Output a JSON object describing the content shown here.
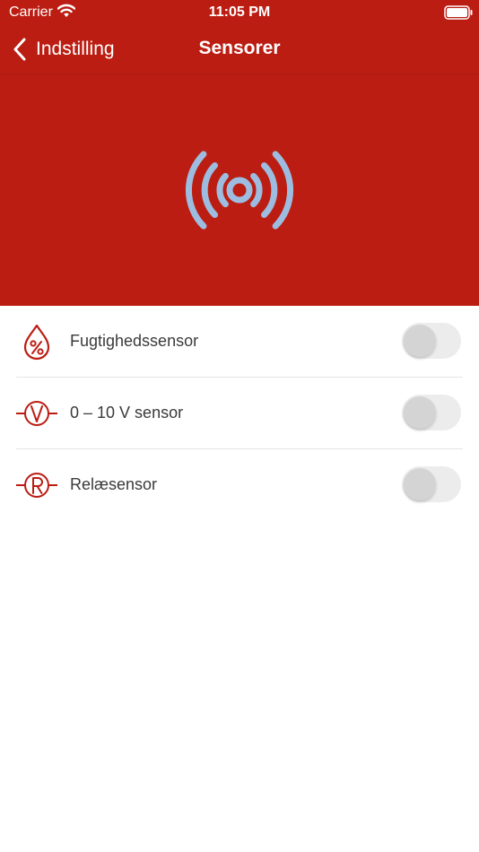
{
  "status_bar": {
    "carrier": "Carrier",
    "time": "11:05 PM"
  },
  "nav": {
    "back_label": "Indstilling",
    "title": "Sensorer"
  },
  "colors": {
    "brand_red": "#bb1d12",
    "hero_icon": "#9dbde0",
    "toggle_off": "#ececec"
  },
  "sensors": [
    {
      "label": "Fugtighedssensor",
      "icon": "humidity-drop-icon",
      "enabled": false
    },
    {
      "label": "0 – 10 V sensor",
      "icon": "voltage-icon",
      "enabled": false
    },
    {
      "label": "Relæsensor",
      "icon": "relay-icon",
      "enabled": false
    }
  ]
}
